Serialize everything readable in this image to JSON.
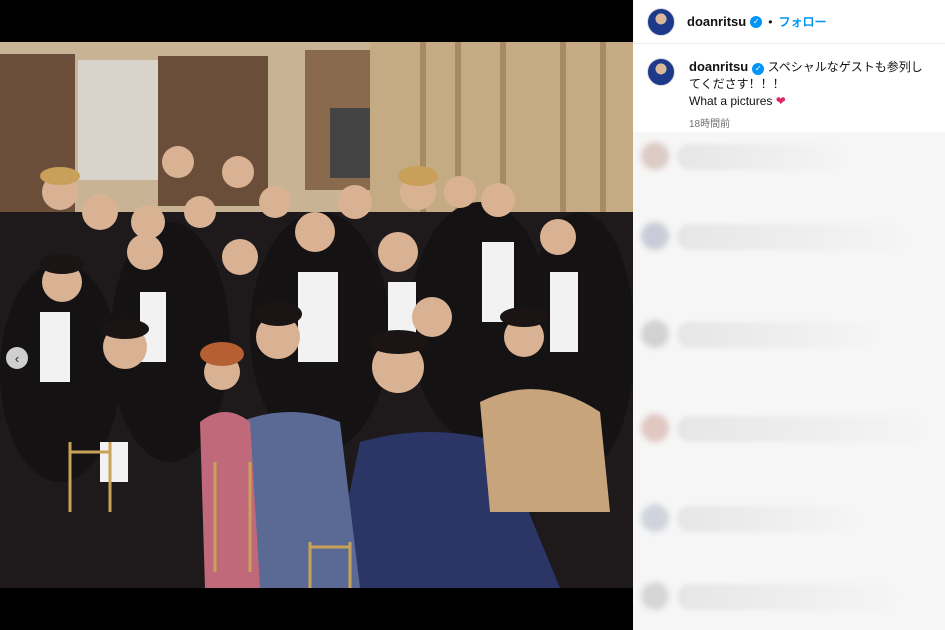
{
  "post": {
    "username": "doanritsu",
    "follow_label": "フォロー",
    "separator": "•",
    "caption_line1": "スペシャルなゲストも参列してくださす！！！",
    "caption_line2": "What a pictures",
    "heart": "❤",
    "timestamp": "18時間前",
    "verified_icon": "verified-badge-icon"
  },
  "media": {
    "prev_icon": "‹",
    "accent": "#0095f6"
  }
}
